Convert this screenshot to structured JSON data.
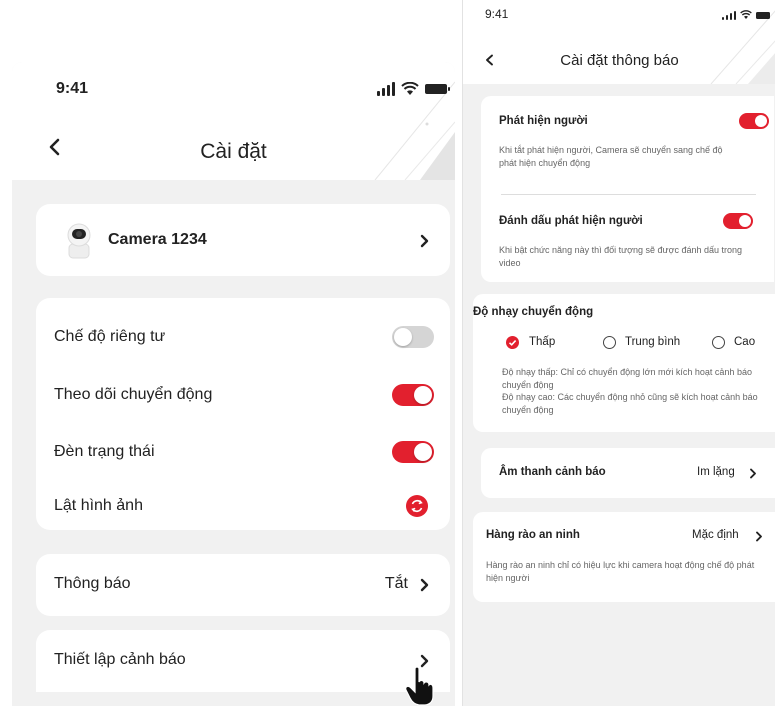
{
  "left": {
    "status": {
      "time": "9:41"
    },
    "header": {
      "title": "Cài đặt"
    },
    "camera": {
      "name": "Camera 1234"
    },
    "settings": [
      {
        "label": "Chế độ riêng tư",
        "control": "toggle",
        "on": false
      },
      {
        "label": "Theo dõi chuyển động",
        "control": "toggle",
        "on": true
      },
      {
        "label": "Đèn trạng thái",
        "control": "toggle",
        "on": true
      },
      {
        "label": "Lật hình ảnh",
        "control": "flip-icon"
      }
    ],
    "notification": {
      "label": "Thông báo",
      "value": "Tắt"
    },
    "alert_setup": {
      "label": "Thiết lập cảnh báo"
    }
  },
  "right": {
    "status": {
      "time": "9:41"
    },
    "header": {
      "title": "Cài đặt thông báo"
    },
    "person_detection": {
      "title": "Phát hiện người",
      "on": true,
      "desc": "Khi tắt phát hiện người, Camera sẽ chuyển sang chế độ phát hiện chuyển động"
    },
    "mark_person": {
      "title": "Đánh dấu phát hiện người",
      "on": true,
      "desc": "Khi bật chức năng này thì đối tượng sẽ được đánh dấu trong video"
    },
    "sensitivity": {
      "title": "Độ nhạy chuyển động",
      "options": [
        {
          "label": "Thấp",
          "selected": true
        },
        {
          "label": "Trung bình",
          "selected": false
        },
        {
          "label": "Cao",
          "selected": false
        }
      ],
      "desc_low": "Độ nhạy thấp: Chỉ có chuyển động lớn mới kích hoạt cảnh báo chuyển động",
      "desc_high": "Độ nhạy cao: Các chuyển động nhỏ cũng sẽ kích hoạt cảnh báo chuyển động"
    },
    "alarm_sound": {
      "label": "Âm thanh cảnh báo",
      "value": "Im lặng"
    },
    "security_fence": {
      "label": "Hàng rào an ninh",
      "value": "Mặc định",
      "desc": "Hàng rào an ninh chỉ có hiệu lực khi camera hoạt động chế độ phát hiện người"
    }
  },
  "colors": {
    "accent": "#e2202e",
    "background": "#f1f1f1",
    "card": "#ffffff",
    "toggle_off": "#d5d5d5"
  }
}
